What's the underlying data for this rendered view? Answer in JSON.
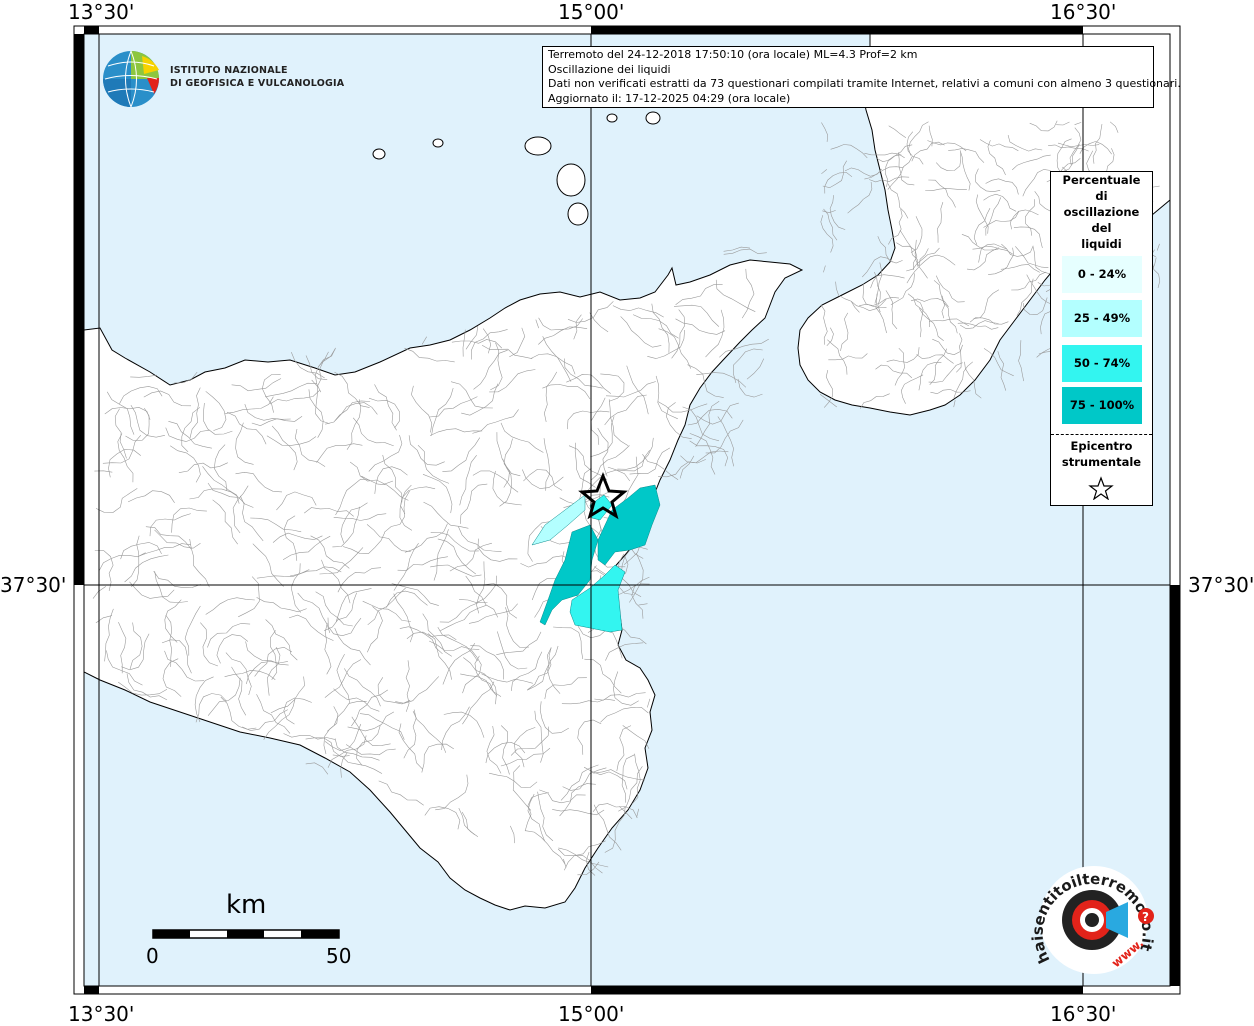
{
  "coordinates": {
    "top": [
      "13°30'",
      "15°00'",
      "16°30'"
    ],
    "bottom": [
      "13°30'",
      "15°00'",
      "16°30'"
    ],
    "left": "37°30'",
    "right": "37°30'"
  },
  "logo": {
    "line1": "ISTITUTO NAZIONALE",
    "line2": "DI GEOFISICA E VULCANOLOGIA"
  },
  "info": {
    "line1": "Terremoto del 24-12-2018 17:50:10 (ora locale) ML=4.3 Prof=2 km",
    "line2": "Oscillazione dei liquidi",
    "line3": "Dati non verificati estratti da 73 questionari compilati tramite Internet, relativi a comuni con almeno 3 questionari.",
    "line4": "Aggiornato il: 17-12-2025 04:29 (ora locale)"
  },
  "legend": {
    "title_lines": [
      "Percentuale",
      "di",
      "oscillazione",
      "del",
      "liquidi"
    ],
    "classes": [
      {
        "label": "0 - 24%",
        "color": "#e6ffff"
      },
      {
        "label": "25 - 49%",
        "color": "#b3ffff"
      },
      {
        "label": "50 - 74%",
        "color": "#33f5f0"
      },
      {
        "label": "75 - 100%",
        "color": "#00c8c8"
      }
    ],
    "epicentre_lines": [
      "Epicentro",
      "strumentale"
    ]
  },
  "scale": {
    "unit": "km",
    "start": "0",
    "end": "50"
  },
  "brand": {
    "text": "haisentitoilterremoto.it",
    "url_text": "www.",
    "question": "?"
  },
  "colors": {
    "sea": "#e0f2fc",
    "land": "#ffffff"
  }
}
